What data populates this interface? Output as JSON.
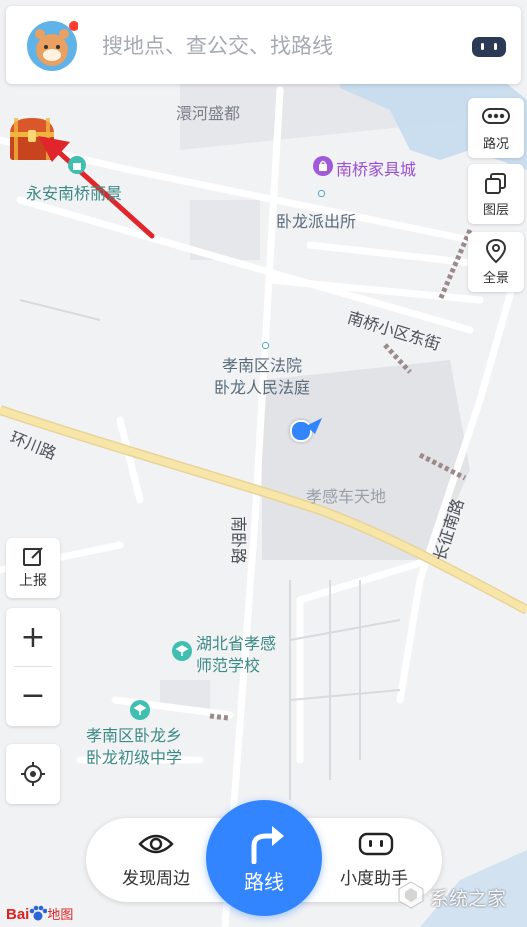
{
  "search": {
    "placeholder": "搜地点、查公交、找路线"
  },
  "right_tools": [
    {
      "label": "路况",
      "icon": "traffic-icon"
    },
    {
      "label": "图层",
      "icon": "layers-icon"
    },
    {
      "label": "全景",
      "icon": "panorama-icon"
    }
  ],
  "left_tools": {
    "report": "上报",
    "zoom_in": "+",
    "zoom_out": "−"
  },
  "map_labels": {
    "huanhe": "澴河盛都",
    "nanqiao_furniture": "南桥家具城",
    "yongan": "永安南桥丽景",
    "wolong_police": "卧龙派出所",
    "nanqiao_street": "南桥小区东街",
    "court1": "孝南区法院",
    "court2": "卧龙人民法庭",
    "huanchuan": "环川路",
    "car_center": "孝感车天地",
    "changzheng": "长征南路",
    "nanwo": "南卧路",
    "school1_line1": "湖北省孝感",
    "school1_line2": "师范学校",
    "school2_line1": "孝南区卧龙乡",
    "school2_line2": "卧龙初级中学"
  },
  "bottom": {
    "discover": "发现周边",
    "route": "路线",
    "assistant": "小度助手"
  },
  "logo": {
    "text": "Bai",
    "suffix": "地图"
  },
  "watermark": "系统之家",
  "colors": {
    "accent": "#3385ff",
    "road_major": "#f5d58a",
    "arrow": "#e0262a",
    "poi_purple": "#a259d9",
    "poi_teal": "#3fbfb0"
  }
}
